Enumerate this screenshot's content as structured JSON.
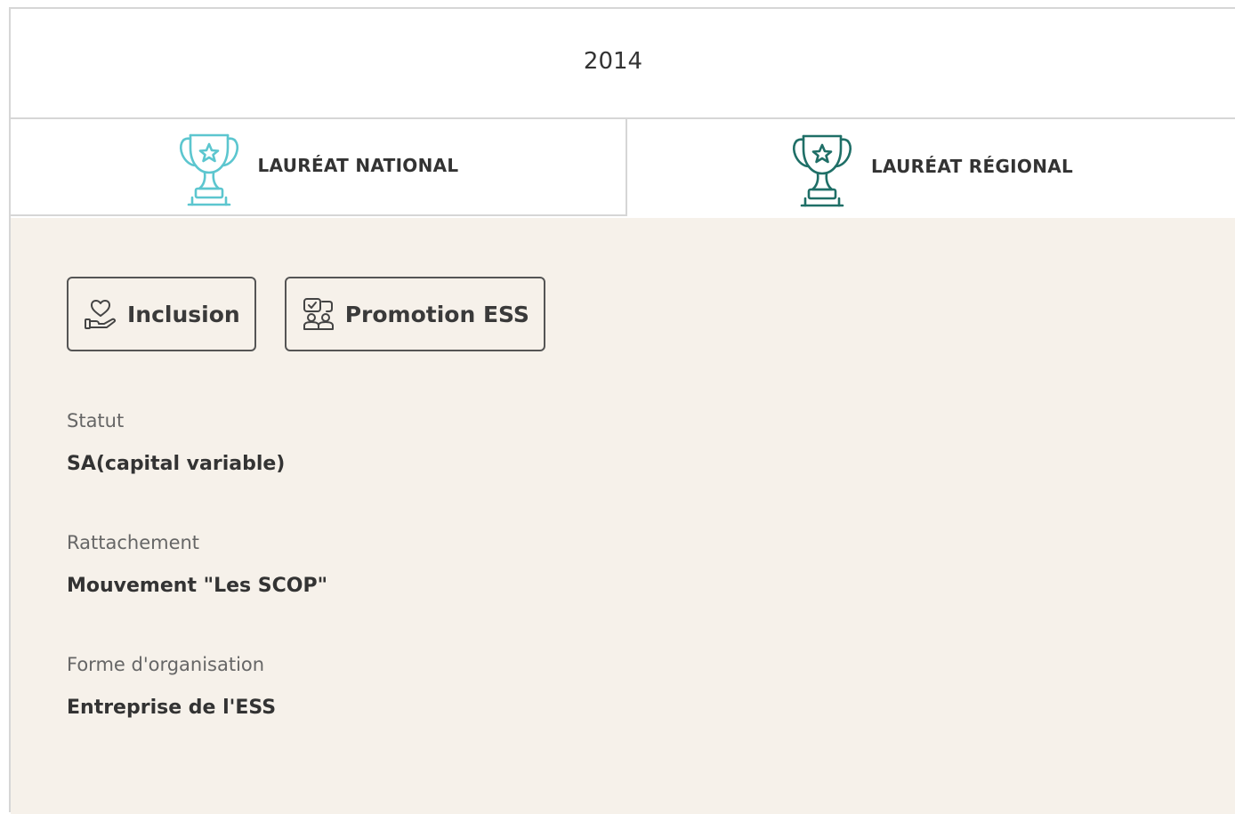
{
  "year": "2014",
  "tabs": {
    "national": {
      "label": "LAURÉAT NATIONAL",
      "icon": "trophy-icon",
      "color": "#5cc6cf"
    },
    "regional": {
      "label": "LAURÉAT RÉGIONAL",
      "icon": "trophy-icon",
      "color": "#1f6f67"
    }
  },
  "tags": [
    {
      "label": "Inclusion",
      "icon": "heart-hand-icon"
    },
    {
      "label": "Promotion ESS",
      "icon": "people-check-icon"
    }
  ],
  "fields": [
    {
      "label": "Statut",
      "value": "SA(capital variable)"
    },
    {
      "label": "Rattachement",
      "value": "Mouvement \"Les SCOP\""
    },
    {
      "label": "Forme d'organisation",
      "value": "Entreprise de l'ESS"
    }
  ],
  "colors": {
    "background": "#f6f1ea",
    "border": "#d6d6d6",
    "national_accent": "#5cc6cf",
    "regional_accent": "#1f6f67"
  }
}
